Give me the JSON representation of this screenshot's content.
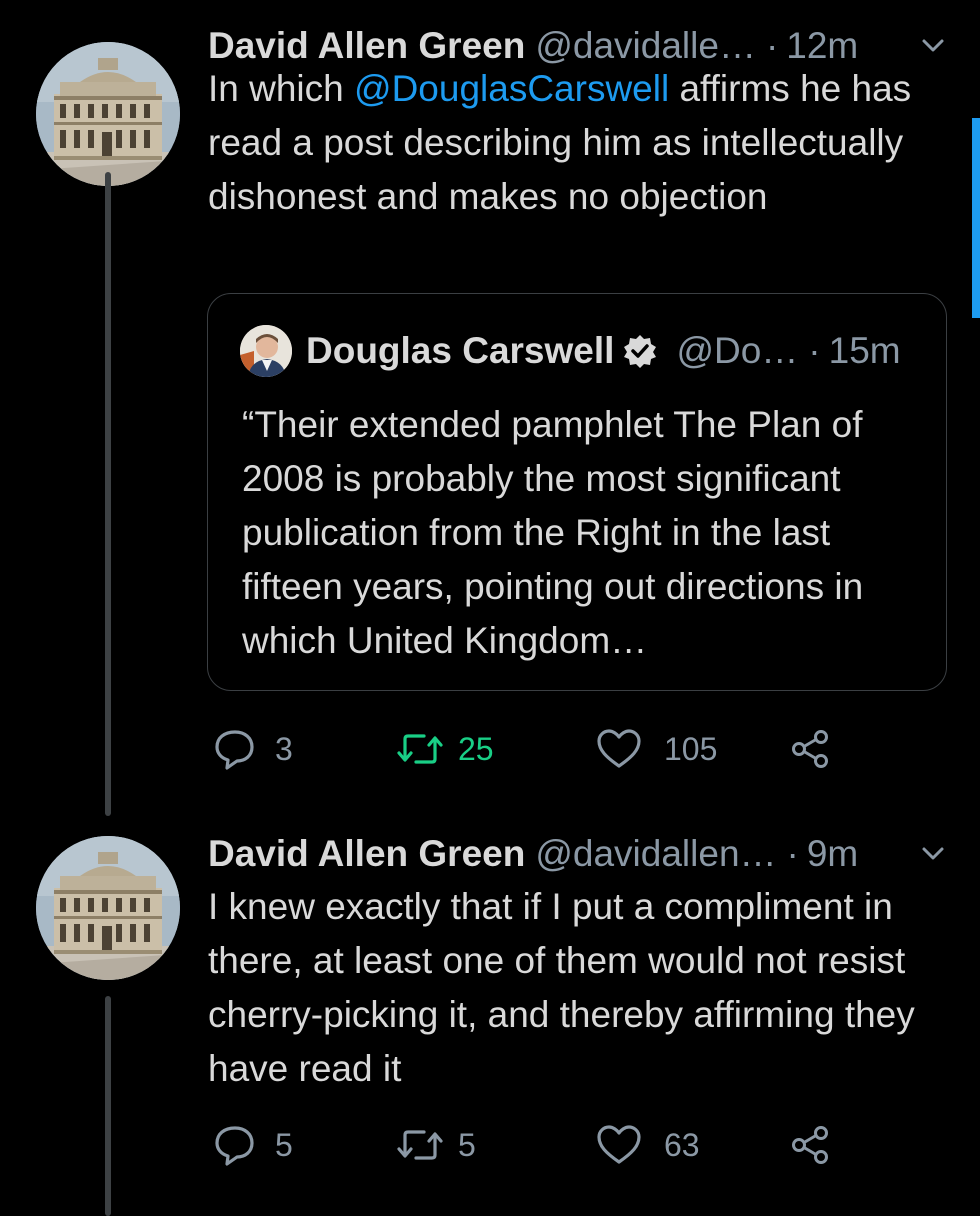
{
  "tweets": [
    {
      "author_name": "David Allen Green",
      "author_handle": "@davidalle…",
      "separator": "·",
      "time": "12m",
      "text_before": "In which ",
      "mention": "@DouglasCarswell",
      "text_after": " affirms he has read a post describing him as intellectually dishonest and makes no objection",
      "quote": {
        "author_name": "Douglas Carswell",
        "author_handle": "@Do…",
        "separator": "·",
        "time": "15m",
        "text": "“Their extended pamphlet The Plan of 2008 is probably the most significant publication from the Right in the last fifteen years, pointing out directions in which United Kingdom…"
      },
      "replies": "3",
      "retweets": "25",
      "likes": "105",
      "retweeted": true
    },
    {
      "author_name": "David Allen Green",
      "author_handle": "@davidallen…",
      "separator": "·",
      "time": "9m",
      "text": "I knew exactly that if I put a compliment in there, at least one of them would not resist cherry-picking it, and thereby affirming they have read it",
      "replies": "5",
      "retweets": "5",
      "likes": "63",
      "retweeted": false
    }
  ],
  "icons": {
    "reply": "reply-icon",
    "retweet": "retweet-icon",
    "like": "heart-icon",
    "share": "share-icon",
    "menu": "chevron-down-icon",
    "verified": "verified-badge-icon"
  },
  "colors": {
    "background": "#000000",
    "text": "#d9d9d9",
    "secondary": "#8b98a5",
    "link": "#1d9bf0",
    "retweet_active": "#19cf86"
  }
}
